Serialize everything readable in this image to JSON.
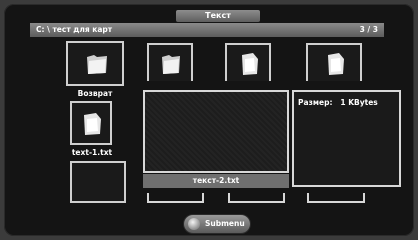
{
  "window": {
    "title": "Текст"
  },
  "path": {
    "text": "C: \\ тест для карт",
    "page": "3 / 3"
  },
  "tiles": {
    "back": {
      "label": "Возврат"
    },
    "text1": {
      "label": "text-1.txt"
    }
  },
  "preview": {
    "filename": "текст-2.txt"
  },
  "info": {
    "size_label": "Размер:",
    "size_value": "1 KBytes"
  },
  "submenu": {
    "label": "Submenu"
  },
  "icons": [
    "folder-icon",
    "document-icon",
    "remote-button-icon"
  ]
}
